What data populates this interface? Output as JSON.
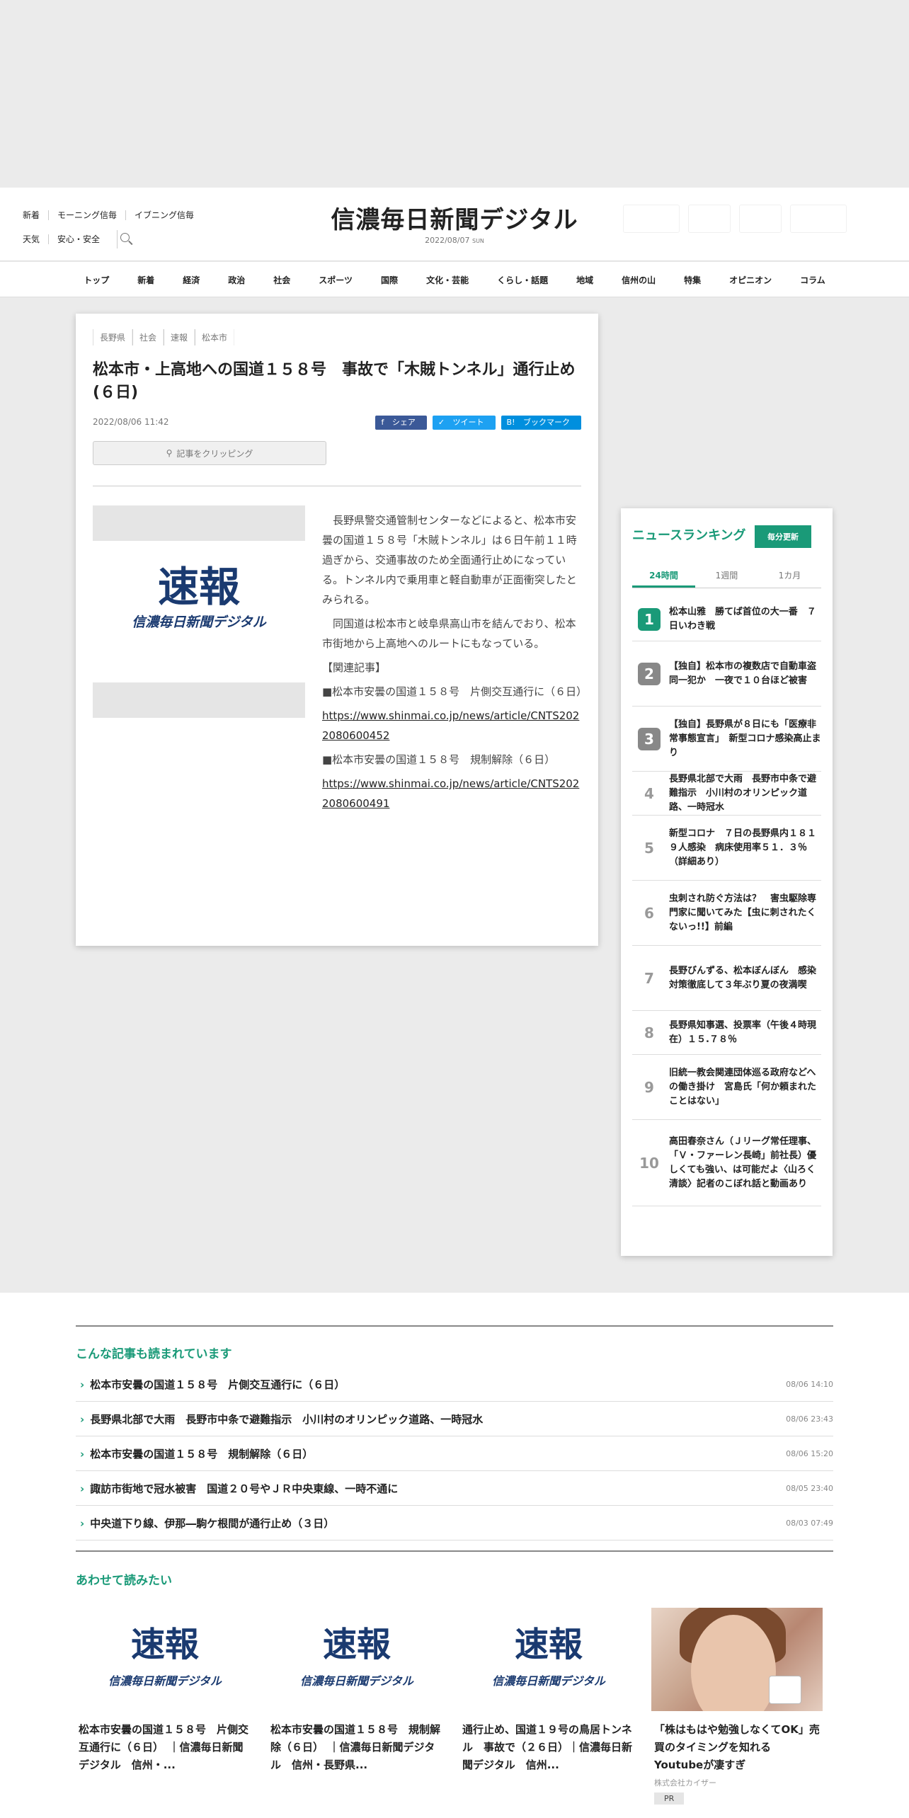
{
  "header": {
    "links_row1": [
      "新着",
      "モーニング信毎",
      "イブニング信毎"
    ],
    "links_row2": [
      "天気",
      "安心・安全"
    ],
    "logo": "信濃毎日新聞デジタル",
    "date": "2022/08/07",
    "weekday": "SUN"
  },
  "nav": [
    "トップ",
    "新着",
    "経済",
    "政治",
    "社会",
    "スポーツ",
    "国際",
    "文化・芸能",
    "くらし・話題",
    "地域",
    "信州の山",
    "特集",
    "オピニオン",
    "コラム"
  ],
  "article": {
    "categories": [
      "長野県",
      "社会",
      "速報",
      "松本市"
    ],
    "title": "松本市・上高地への国道１５８号　事故で「木賊トンネル」通行止め(６日)",
    "date": "2022/08/06 11:42",
    "share": [
      "シェア",
      "ツイート",
      "ブックマーク"
    ],
    "share_colors": [
      "#3b5998",
      "#1da1f2",
      "#008fde"
    ],
    "clip_label": "記事をクリッピング",
    "image_text": "速報",
    "image_sub": "信濃毎日新聞デジタル",
    "p1": "　長野県警交通管制センターなどによると、松本市安曇の国道１５８号「木賊トンネル」は６日午前１１時過ぎから、交通事故のため全面通行止めになっている。トンネル内で乗用車と軽自動車が正面衝突したとみられる。",
    "p2": "　同国道は松本市と岐阜県高山市を結んでおり、松本市街地から上高地へのルートにもなっている。",
    "related_label": "【関連記事】",
    "rel1": "■松本市安曇の国道１５８号　片側交互通行に（６日）",
    "rel1_url": "https://www.shinmai.co.jp/news/article/CNTS2022080600452",
    "rel2": "■松本市安曇の国道１５８号　規制解除（６日）",
    "rel2_url": "https://www.shinmai.co.jp/news/article/CNTS2022080600491"
  },
  "ranking": {
    "title": "ニュースランキング",
    "update": "毎分更新",
    "tabs": [
      "24時間",
      "1週間",
      "1カ月"
    ],
    "items": [
      {
        "n": "1",
        "t": "松本山雅　勝てば首位の大一番　７日いわき戦"
      },
      {
        "n": "2",
        "t": "【独自】松本市の複数店で自動車盗　同一犯か　一夜で１０台ほど被害"
      },
      {
        "n": "3",
        "t": "【独自】長野県が８日にも「医療非常事態宣言」　新型コロナ感染高止まり"
      },
      {
        "n": "4",
        "t": "長野県北部で大雨　長野市中条で避難指示　小川村のオリンピック道路、一時冠水"
      },
      {
        "n": "5",
        "t": "新型コロナ　７日の長野県内１８１９人感染　病床使用率５１．３％（詳細あり）"
      },
      {
        "n": "6",
        "t": "虫刺され防ぐ方法は？　害虫駆除専門家に聞いてみた【虫に刺されたくないっ!!】前編"
      },
      {
        "n": "7",
        "t": "長野びんずる、松本ぼんぼん　感染対策徹底して３年ぶり夏の夜満喫"
      },
      {
        "n": "8",
        "t": "長野県知事選、投票率（午後４時現在）１５.７８％"
      },
      {
        "n": "9",
        "t": "旧統一教会関連団体巡る政府などへの働き掛け　宮島氏「何か頼まれたことはない」"
      },
      {
        "n": "10",
        "t": "高田春奈さん（Ｊリーグ常任理事、「Ｖ・ファーレン長崎」前社長）優しくても強い、は可能だよ〈山ろく清談〉記者のこぼれ話と動画あり"
      }
    ],
    "badge_colors": [
      "#1a9a78",
      "#888",
      "#888"
    ]
  },
  "related": {
    "title": "こんな記事も読まれています",
    "items": [
      {
        "t": "松本市安曇の国道１５８号　片側交互通行に（６日）",
        "d": "08/06 14:10"
      },
      {
        "t": "長野県北部で大雨　長野市中条で避難指示　小川村のオリンピック道路、一時冠水",
        "d": "08/06 23:43"
      },
      {
        "t": "松本市安曇の国道１５８号　規制解除（６日）",
        "d": "08/06 15:20"
      },
      {
        "t": "諏訪市街地で冠水被害　国道２０号やＪＲ中央東線、一時不通に",
        "d": "08/05 23:40"
      },
      {
        "t": "中央道下り線、伊那―駒ケ根間が通行止め（３日）",
        "d": "08/03 07:49"
      }
    ]
  },
  "recommend": {
    "title": "あわせて読みたい",
    "cards": [
      {
        "t": "松本市安曇の国道１５８号　片側交互通行に（６日）　｜信濃毎日新聞デジタル　信州・..."
      },
      {
        "t": "松本市安曇の国道１５８号　規制解除（６日）　｜信濃毎日新聞デジタル　信州・長野県..."
      },
      {
        "t": "通行止め、国道１９号の鳥居トンネル　事故で（２６日）｜信濃毎日新聞デジタル　信州..."
      }
    ],
    "ad": {
      "t": "「株はもはや勉強しなくてOK」売買のタイミングを知れるYoutubeが凄すぎ",
      "sponsor": "株式会社カイザー",
      "badge": "PR"
    }
  }
}
